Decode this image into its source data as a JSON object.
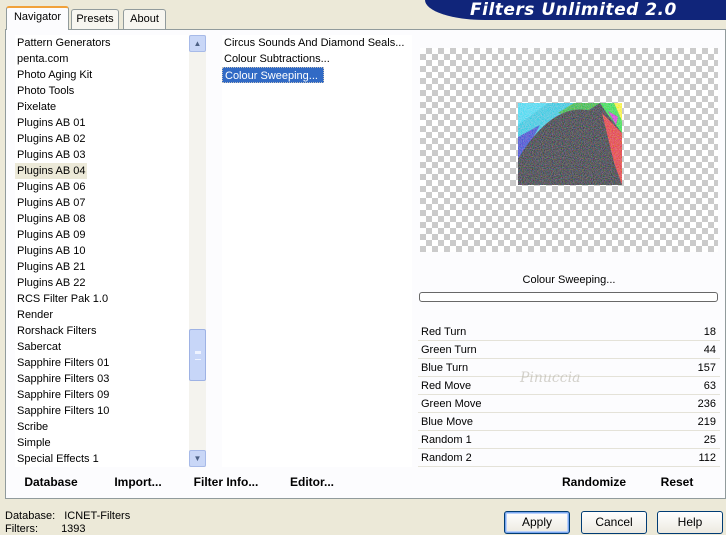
{
  "header": {
    "title": "Filters Unlimited 2.0"
  },
  "tabs": [
    {
      "label": "Navigator",
      "active": true
    },
    {
      "label": "Presets",
      "active": false
    },
    {
      "label": "About",
      "active": false
    }
  ],
  "categories": {
    "items": [
      "Pattern Generators",
      "penta.com",
      "Photo Aging Kit",
      "Photo Tools",
      "Pixelate",
      "Plugins AB 01",
      "Plugins AB 02",
      "Plugins AB 03",
      "Plugins AB 04",
      "Plugins AB 06",
      "Plugins AB 07",
      "Plugins AB 08",
      "Plugins AB 09",
      "Plugins AB 10",
      "Plugins AB 21",
      "Plugins AB 22",
      "RCS Filter Pak 1.0",
      "Render",
      "Rorshack Filters",
      "Sabercat",
      "Sapphire Filters 01",
      "Sapphire Filters 03",
      "Sapphire Filters 09",
      "Sapphire Filters 10",
      "Scribe",
      "Simple",
      "Special Effects 1"
    ],
    "selected": "Plugins AB 04"
  },
  "filters": {
    "items": [
      "Circus Sounds And Diamond Seals...",
      "Colour Subtractions...",
      "Colour Sweeping..."
    ],
    "selected": "Colour Sweeping..."
  },
  "preview": {
    "filter_name": "Colour Sweeping...",
    "progress": 0
  },
  "sliders": [
    {
      "label": "Red Turn",
      "value": 18
    },
    {
      "label": "Green Turn",
      "value": 44
    },
    {
      "label": "Blue Turn",
      "value": 157
    },
    {
      "label": "Red Move",
      "value": 63
    },
    {
      "label": "Green Move",
      "value": 236
    },
    {
      "label": "Blue Move",
      "value": 219
    },
    {
      "label": "Random 1",
      "value": 25
    },
    {
      "label": "Random 2",
      "value": 112
    }
  ],
  "pane_buttons": {
    "database": "Database",
    "import": "Import...",
    "filter_info": "Filter Info...",
    "editor": "Editor...",
    "randomize": "Randomize",
    "reset": "Reset"
  },
  "status": {
    "database_label": "Database:",
    "database_value": "ICNET-Filters",
    "filters_label": "Filters:",
    "filters_value": "1393"
  },
  "dialog_buttons": {
    "apply": "Apply",
    "cancel": "Cancel",
    "help": "Help"
  },
  "colors": {
    "banner": "#10257a",
    "selection": "#316ac5",
    "accent_tab": "#f1a13a"
  },
  "watermark": {
    "text": "Pinuccia"
  }
}
